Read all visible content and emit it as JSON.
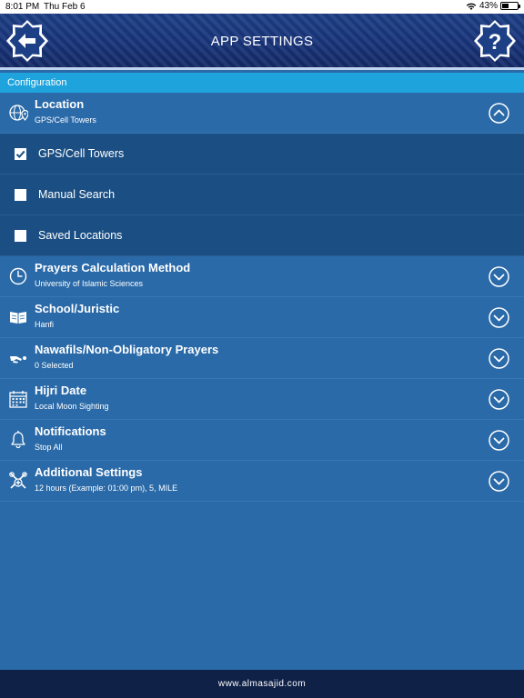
{
  "status": {
    "time": "8:01 PM",
    "date": "Thu Feb 6",
    "battery": "43%"
  },
  "header": {
    "title": "APP SETTINGS"
  },
  "section": {
    "title": "Configuration"
  },
  "location": {
    "label": "Location",
    "value": "GPS/Cell Towers",
    "expanded": true,
    "options": [
      {
        "label": "GPS/Cell Towers",
        "checked": true
      },
      {
        "label": "Manual Search",
        "checked": false
      },
      {
        "label": "Saved Locations",
        "checked": false
      }
    ]
  },
  "settings": [
    {
      "label": "Prayers Calculation Method",
      "value": "University of Islamic Sciences",
      "icon": "clock-icon"
    },
    {
      "label": "School/Juristic",
      "value": "Hanfi",
      "icon": "book-icon"
    },
    {
      "label": "Nawafils/Non-Obligatory Prayers",
      "value": "0 Selected",
      "icon": "prostration-icon"
    },
    {
      "label": "Hijri Date",
      "value": "Local Moon Sighting",
      "icon": "calendar-icon"
    },
    {
      "label": "Notifications",
      "value": "Stop All",
      "icon": "bell-icon"
    },
    {
      "label": "Additional Settings",
      "value": "12 hours (Example: 01:00 pm), 5, MILE",
      "icon": "tools-icon"
    }
  ],
  "footer": {
    "text": "www.almasajid.com"
  }
}
